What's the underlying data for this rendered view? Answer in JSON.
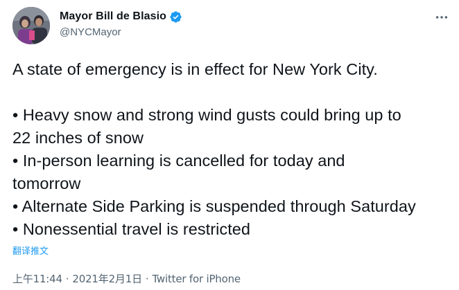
{
  "author": {
    "display_name": "Mayor Bill de Blasio",
    "handle": "@NYCMayor",
    "verified": true,
    "avatar_icon": "profile-photo"
  },
  "tweet": {
    "lines": [
      "A state of emergency is in effect for New York City.",
      "",
      "• Heavy snow and strong wind gusts could bring up to",
      "22 inches of snow",
      "• In-person learning is cancelled for today and",
      "tomorrow",
      "• Alternate Side Parking is suspended through Saturday",
      "• Nonessential travel is restricted"
    ],
    "translate_label": "翻译推文"
  },
  "meta": {
    "time": "上午11:44",
    "separator": "·",
    "date": "2021年2月1日",
    "source": "Twitter for iPhone"
  },
  "colors": {
    "accent": "#1d9bf0",
    "secondary_text": "#536471",
    "primary_text": "#0f1419"
  }
}
